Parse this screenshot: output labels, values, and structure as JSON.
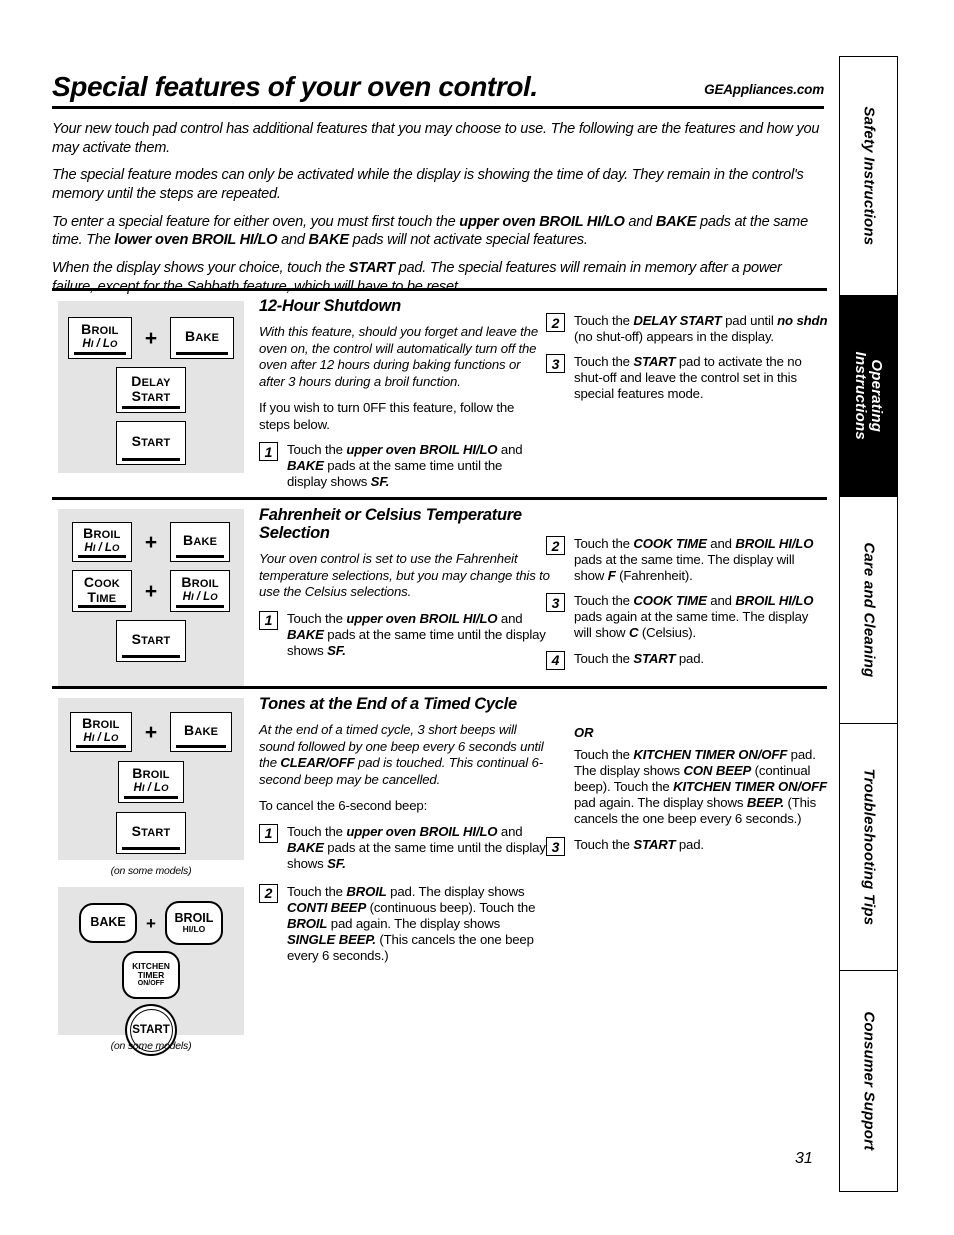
{
  "header": {
    "title": "Special features of your oven control.",
    "website": "GEAppliances.com"
  },
  "intro": [
    "Your new touch pad control has additional features that you may choose to use. The following are the features and how you may activate them.",
    "The special feature modes can only be activated while the display is showing the time of day. They remain in the control's memory until the steps are repeated."
  ],
  "intro_rich": {
    "p3_a": "To enter a special feature for either oven, you must first touch the ",
    "p3_b1": "upper oven BROIL HI/LO",
    "p3_c": " and ",
    "p3_b2": "BAKE",
    "p3_d": " pads at the same time. The ",
    "p3_b3": "lower oven BROIL HI/LO",
    "p3_e": " and ",
    "p3_b4": "BAKE",
    "p3_f": " pads will not activate special features.",
    "p4_a": "When the display shows your choice, touch the ",
    "p4_b1": "START",
    "p4_c": " pad. The special features will remain in memory after a power failure, except for the Sabbath feature, which will have to be reset."
  },
  "sections": [
    {
      "heading": "12-Hour Shutdown",
      "intro": "With this feature, should you forget and leave the oven on, the control will automatically turn off the oven after 12 hours during baking functions or after 3 hours during a broil function.",
      "note": "If you wish to turn 0FF  this feature, follow the steps below.",
      "pads": [
        {
          "l1": "Broil",
          "l2": "Hi / Lo"
        },
        {
          "l1": "Bake",
          "l2": ""
        },
        {
          "l1": "Delay",
          "l1b": "Start",
          "l2": ""
        },
        {
          "l1": "Start",
          "l2": ""
        }
      ],
      "steps_left": [
        {
          "num": "1",
          "a": "Touch the ",
          "b1": "upper oven BROIL HI/LO",
          "c": " and ",
          "b2": "BAKE",
          "d": " pads at the same time until the display shows ",
          "b3": "SF.",
          "e": ""
        }
      ],
      "steps_right": [
        {
          "num": "2",
          "a": "Touch the ",
          "b1": "DELAY START",
          "c": " pad until ",
          "b2": "no shdn",
          "d": " (no shut-off) appears in the display.",
          "b3": "",
          "e": ""
        },
        {
          "num": "3",
          "a": "Touch the ",
          "b1": "START",
          "c": " pad to activate the no shut-off and leave the control set in this special features mode.",
          "b2": "",
          "d": "",
          "b3": "",
          "e": ""
        }
      ]
    },
    {
      "heading": "Fahrenheit or Celsius Temperature Selection",
      "intro": "Your oven control is set to use the Fahrenheit temperature selections, but you may change this to use the Celsius selections.",
      "note": "",
      "pads": [
        {
          "l1": "Broil",
          "l2": "Hi / Lo"
        },
        {
          "l1": "Bake",
          "l2": ""
        },
        {
          "l1": "Cook",
          "l1b": "Time",
          "l2": ""
        },
        {
          "l1": "Broil",
          "l2": "Hi / Lo"
        },
        {
          "l1": "Start",
          "l2": ""
        }
      ],
      "steps_left": [
        {
          "num": "1",
          "a": "Touch the ",
          "b1": "upper oven BROIL HI/LO",
          "c": " and ",
          "b2": "BAKE",
          "d": " pads at the same time until the display shows ",
          "b3": "SF.",
          "e": ""
        }
      ],
      "steps_right": [
        {
          "num": "2",
          "a": "Touch the ",
          "b1": "COOK TIME",
          "c": " and ",
          "b2": "BROIL HI/LO",
          "d": " pads at the same time. The display will show ",
          "b3": "F",
          "e": " (Fahrenheit)."
        },
        {
          "num": "3",
          "a": "Touch the ",
          "b1": "COOK TIME",
          "c": " and ",
          "b2": "BROIL HI/LO",
          "d": " pads again at the same time. The display will show ",
          "b3": "C",
          "e": " (Celsius)."
        },
        {
          "num": "4",
          "a": "Touch the ",
          "b1": "START",
          "c": " pad.",
          "b2": "",
          "d": "",
          "b3": "",
          "e": ""
        }
      ]
    },
    {
      "heading": "Tones at the End of a Timed Cycle",
      "intro_a": "At the end of a timed cycle, 3 short beeps will sound followed by one beep every 6 seconds until the ",
      "intro_b": "CLEAR/OFF",
      "intro_c": " pad is touched. This continual 6-second beep may be cancelled.",
      "note": "To cancel the 6-second beep:",
      "pads": [
        {
          "l1": "Broil",
          "l2": "Hi / Lo"
        },
        {
          "l1": "Bake",
          "l2": ""
        },
        {
          "l1": "Broil",
          "l2": "Hi / Lo"
        },
        {
          "l1": "Start",
          "l2": ""
        }
      ],
      "panel_note": "(on some models)",
      "steps_left": [
        {
          "num": "1",
          "a": "Touch the ",
          "b1": "upper oven BROIL HI/LO",
          "c": " and ",
          "b2": "BAKE",
          "d": " pads at the same time until the display shows ",
          "b3": "SF.",
          "e": ""
        },
        {
          "num": "2",
          "a": "Touch the ",
          "b1": "BROIL",
          "c": " pad. The display shows ",
          "b2": "CONTI BEEP",
          "d": " (continuous beep). Touch the ",
          "b3": "BROIL",
          "e": " pad again. The display shows ",
          "b4": "SINGLE BEEP.",
          "f": " (This cancels the one beep every 6 seconds.)"
        }
      ],
      "or_label": "OR",
      "or_text": {
        "a": "Touch the ",
        "b1": "KITCHEN TIMER ON/OFF",
        "c": " pad. The display shows ",
        "b2": "CON BEEP",
        "d": " (continual beep). Touch the ",
        "b3": "KITCHEN TIMER ON/OFF",
        "e": " pad again. The display shows ",
        "b4": "BEEP.",
        "f": " (This cancels the one beep every 6 seconds.)"
      },
      "steps_right": [
        {
          "num": "3",
          "a": "Touch the ",
          "b1": "START",
          "c": " pad.",
          "b2": "",
          "d": "",
          "b3": "",
          "e": ""
        }
      ]
    }
  ],
  "round_panel": {
    "pads": [
      {
        "r1": "BAKE"
      },
      {
        "r1": "BROIL",
        "r2": "HI/LO"
      },
      {
        "r1": "KITCHEN",
        "r2": "TIMER",
        "r3": "ON/OFF"
      },
      {
        "r1": "START"
      }
    ],
    "note": "(on some models)"
  },
  "sidebar": {
    "tabs": [
      {
        "label": "Safety Instructions",
        "active": false
      },
      {
        "label": "Operating Instructions",
        "active": true,
        "line1": "Operating",
        "line2": "Instructions"
      },
      {
        "label": "Care and Cleaning",
        "active": false
      },
      {
        "label": "Troubleshooting Tips",
        "active": false
      },
      {
        "label": "Consumer Support",
        "active": false
      }
    ]
  },
  "page_number": "31"
}
